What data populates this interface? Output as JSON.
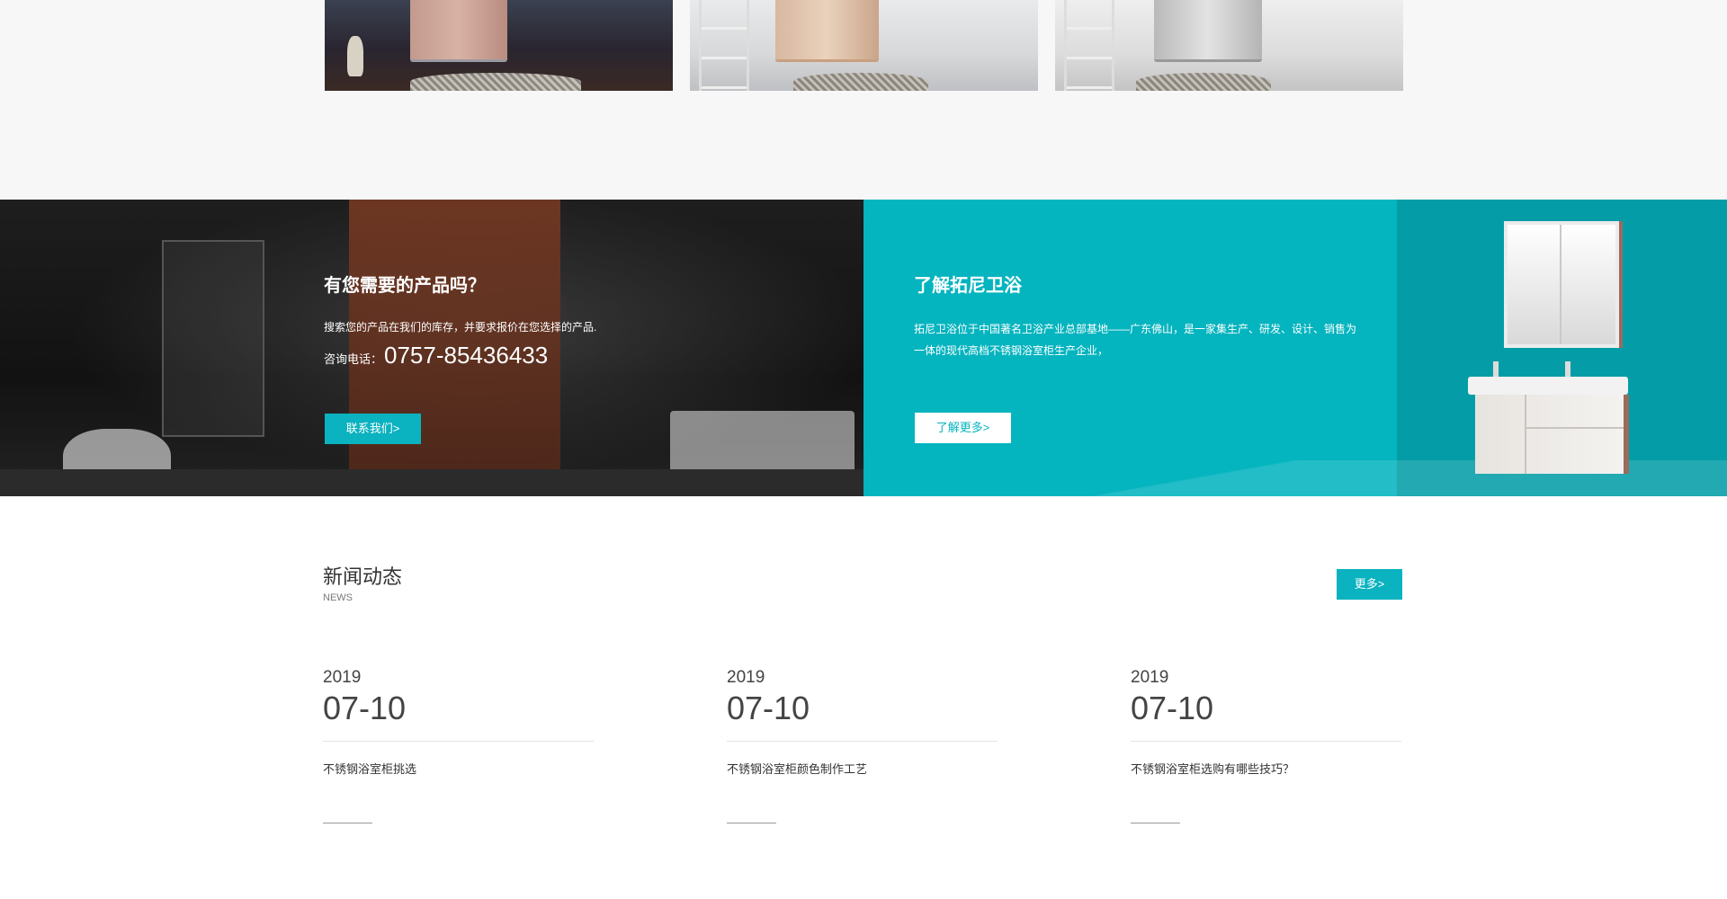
{
  "products": {
    "items": [
      {
        "name": "cabinet-dark"
      },
      {
        "name": "cabinet-beige"
      },
      {
        "name": "cabinet-silver"
      }
    ]
  },
  "contact_banner": {
    "title": "有您需要的产品吗？",
    "description": "搜索您的产品在我们的库存，并要求报价在您选择的产品.",
    "phone_label": "咨询电话：",
    "phone_number": "0757-85436433",
    "button_label": "联系我们>"
  },
  "about_banner": {
    "title": "了解拓尼卫浴",
    "description": "拓尼卫浴位于中国著名卫浴产业总部基地——广东佛山，是一家集生产、研发、设计、销售为一体的现代高档不锈钢浴室柜生产企业，",
    "button_label": "了解更多>"
  },
  "news": {
    "title": "新闻动态",
    "subtitle": "NEWS",
    "more_label": "更多>",
    "items": [
      {
        "year": "2019",
        "date": "07-10",
        "title": "不锈钢浴室柜挑选"
      },
      {
        "year": "2019",
        "date": "07-10",
        "title": "不锈钢浴室柜颜色制作工艺"
      },
      {
        "year": "2019",
        "date": "07-10",
        "title": "不锈钢浴室柜选购有哪些技巧？"
      }
    ]
  },
  "colors": {
    "accent": "#0bb2bf",
    "teal_panel": "#04b4bf",
    "background_light": "#f7f7f7"
  }
}
